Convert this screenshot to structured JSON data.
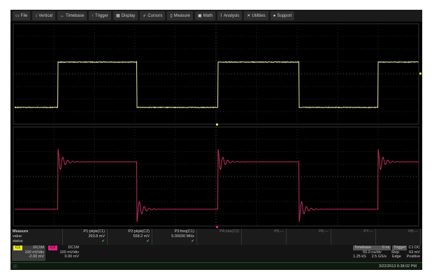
{
  "menu": [
    {
      "label": "File",
      "icon": "folder-icon",
      "g": "▭"
    },
    {
      "label": "Vertical",
      "icon": "vertical-icon",
      "g": "↕"
    },
    {
      "label": "Timebase",
      "icon": "timebase-icon",
      "g": "↔"
    },
    {
      "label": "Trigger",
      "icon": "trigger-icon",
      "g": "↑"
    },
    {
      "label": "Display",
      "icon": "display-icon",
      "g": "▦"
    },
    {
      "label": "Cursors",
      "icon": "cursor-icon",
      "g": "➶"
    },
    {
      "label": "Measure",
      "icon": "measure-icon",
      "g": "▯"
    },
    {
      "label": "Math",
      "icon": "math-icon",
      "g": "▣"
    },
    {
      "label": "Analysis",
      "icon": "analysis-icon",
      "g": "⌇"
    },
    {
      "label": "Utilities",
      "icon": "utilities-icon",
      "g": "✕"
    },
    {
      "label": "Support",
      "icon": "support-icon",
      "g": "●"
    }
  ],
  "measure": {
    "header": "Measure",
    "rows": [
      "value",
      "status"
    ],
    "params": [
      {
        "name": "P1:pkpk(C1)",
        "value": "263.8 mV",
        "ok": "✔"
      },
      {
        "name": "P2:pkpk(C2)",
        "value": "558.2 mV",
        "ok": "✔"
      },
      {
        "name": "P3:freq(C1)",
        "value": "5.00030 MHz",
        "ok": "✔"
      },
      {
        "name": "P4:rise(C2)",
        "value": "",
        "ok": ""
      },
      {
        "name": "P5:---",
        "value": "",
        "ok": ""
      },
      {
        "name": "P6:---",
        "value": "",
        "ok": ""
      },
      {
        "name": "P7:---",
        "value": "",
        "ok": ""
      },
      {
        "name": "P8:---",
        "value": "",
        "ok": ""
      }
    ]
  },
  "channels": [
    {
      "tag": "C1",
      "coupling": "DC1M",
      "scale": "100 mV/div",
      "offset": "-2.00 mV",
      "color": "#e8e830"
    },
    {
      "tag": "C2",
      "coupling": "DC1M",
      "scale": "100 mV/div",
      "offset": "0.00 mV",
      "color": "#e0208a"
    }
  ],
  "timebase": {
    "label": "Timebase",
    "delay": "0 ns",
    "scale": "50.0 ns/div",
    "samples": "1.25 kS",
    "rate": "2.5 GS/s"
  },
  "trigger": {
    "label": "Trigger",
    "channels": "C1 DC",
    "mode": "Stop",
    "level": "63 mV",
    "type": "Edge",
    "slope": "Positive"
  },
  "status": {
    "datetime": "3/22/2013 6:38:02 PM"
  },
  "colors": {
    "c1": "#e8e8a0",
    "c2": "#c0305a"
  }
}
